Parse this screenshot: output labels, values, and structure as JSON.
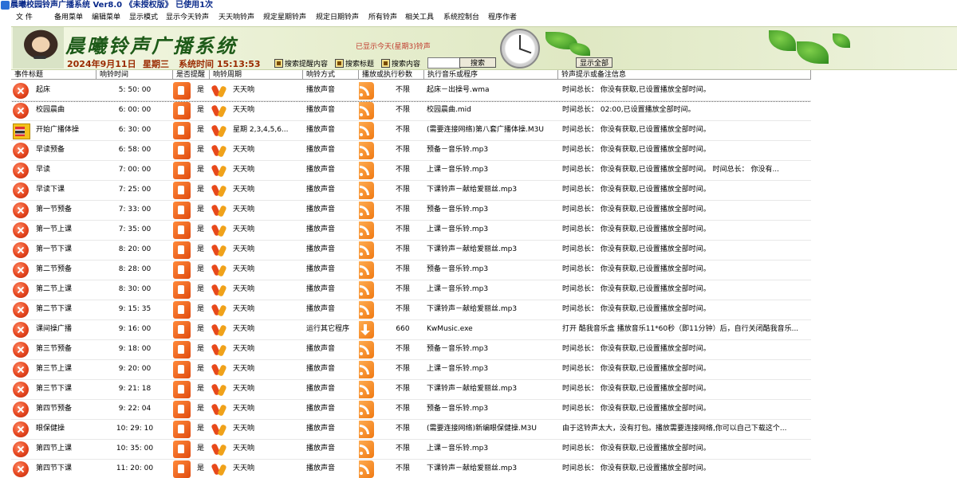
{
  "window": {
    "title": "晨曦校园铃声广播系统 Ver8.0 《未授权版》  已使用1次"
  },
  "menu": [
    "文 件",
    "备用菜单",
    "编辑菜单",
    "显示模式",
    "显示今天铃声",
    "天天响铃声",
    "规定星期铃声",
    "规定日期铃声",
    "所有铃声",
    "相关工具",
    "系统控制台",
    "程序作者"
  ],
  "banner": {
    "logo_text": "晨曦铃声广播系统",
    "today_shown": "已显示今天(星期3)铃声",
    "date": "2024年9月11日",
    "weekday": "星期三",
    "system_time": "系统时间 15:13:53",
    "search_options": [
      "搜索提醒内容",
      "搜索标题",
      "搜索内容"
    ],
    "search_value": "",
    "search_button": "搜索",
    "show_all_button": "显示全部"
  },
  "columns": [
    "事件标题",
    "响铃时间",
    "是否提醒",
    "响铃周期",
    "响铃方式",
    "播放或执行秒数",
    "执行音乐或程序",
    "铃声提示或备注信息"
  ],
  "rows": [
    {
      "icon": "x-icon",
      "title": "起床",
      "time": "5: 50: 00",
      "remind": "是",
      "cycle": "天天响",
      "mode": "播放声音",
      "mode_icon": "rss-icon",
      "seconds": "不限",
      "program": "起床－出操号.wma",
      "note": "时间总长： 你没有获取,已设置播放全部时间。"
    },
    {
      "icon": "x-icon",
      "title": "校园晨曲",
      "time": "6: 00: 00",
      "remind": "是",
      "cycle": "天天响",
      "mode": "播放声音",
      "mode_icon": "rss-icon",
      "seconds": "不限",
      "program": "校园晨曲.mid",
      "note": "时间总长： 02:00,已设置播放全部时间。"
    },
    {
      "icon": "mat-icon",
      "title": "开始广播体操",
      "time": "6: 30: 00",
      "remind": "是",
      "cycle": "星期 2,3,4,5,6...",
      "mode": "播放声音",
      "mode_icon": "rss-icon",
      "seconds": "不限",
      "program": "(需要连接网络)第八套广播体操.M3U",
      "note": "时间总长： 你没有获取,已设置播放全部时间。"
    },
    {
      "icon": "x-icon",
      "title": "早读预备",
      "time": "6: 58: 00",
      "remind": "是",
      "cycle": "天天响",
      "mode": "播放声音",
      "mode_icon": "rss-icon",
      "seconds": "不限",
      "program": "预备－音乐铃.mp3",
      "note": "时间总长： 你没有获取,已设置播放全部时间。"
    },
    {
      "icon": "x-icon",
      "title": "早读",
      "time": "7: 00: 00",
      "remind": "是",
      "cycle": "天天响",
      "mode": "播放声音",
      "mode_icon": "rss-icon",
      "seconds": "不限",
      "program": "上课－音乐铃.mp3",
      "note": "时间总长： 你没有获取,已设置播放全部时间。 时间总长： 你没有..."
    },
    {
      "icon": "x-icon",
      "title": "早读下课",
      "time": "7: 25: 00",
      "remind": "是",
      "cycle": "天天响",
      "mode": "播放声音",
      "mode_icon": "rss-icon",
      "seconds": "不限",
      "program": "下课铃声－献给爱丽丝.mp3",
      "note": "时间总长： 你没有获取,已设置播放全部时间。"
    },
    {
      "icon": "x-icon",
      "title": "第一节预备",
      "time": "7: 33: 00",
      "remind": "是",
      "cycle": "天天响",
      "mode": "播放声音",
      "mode_icon": "rss-icon",
      "seconds": "不限",
      "program": "预备－音乐铃.mp3",
      "note": "时间总长： 你没有获取,已设置播放全部时间。"
    },
    {
      "icon": "x-icon",
      "title": "第一节上课",
      "time": "7: 35: 00",
      "remind": "是",
      "cycle": "天天响",
      "mode": "播放声音",
      "mode_icon": "rss-icon",
      "seconds": "不限",
      "program": "上课－音乐铃.mp3",
      "note": "时间总长： 你没有获取,已设置播放全部时间。"
    },
    {
      "icon": "x-icon",
      "title": "第一节下课",
      "time": "8: 20: 00",
      "remind": "是",
      "cycle": "天天响",
      "mode": "播放声音",
      "mode_icon": "rss-icon",
      "seconds": "不限",
      "program": "下课铃声－献给爱丽丝.mp3",
      "note": "时间总长： 你没有获取,已设置播放全部时间。"
    },
    {
      "icon": "x-icon",
      "title": "第二节预备",
      "time": "8: 28: 00",
      "remind": "是",
      "cycle": "天天响",
      "mode": "播放声音",
      "mode_icon": "rss-icon",
      "seconds": "不限",
      "program": "预备－音乐铃.mp3",
      "note": "时间总长： 你没有获取,已设置播放全部时间。"
    },
    {
      "icon": "x-icon",
      "title": "第二节上课",
      "time": "8: 30: 00",
      "remind": "是",
      "cycle": "天天响",
      "mode": "播放声音",
      "mode_icon": "rss-icon",
      "seconds": "不限",
      "program": "上课－音乐铃.mp3",
      "note": "时间总长： 你没有获取,已设置播放全部时间。"
    },
    {
      "icon": "x-icon",
      "title": "第二节下课",
      "time": "9: 15: 35",
      "remind": "是",
      "cycle": "天天响",
      "mode": "播放声音",
      "mode_icon": "rss-icon",
      "seconds": "不限",
      "program": "下课铃声－献给爱丽丝.mp3",
      "note": "时间总长： 你没有获取,已设置播放全部时间。"
    },
    {
      "icon": "x-icon",
      "title": "课间操广播",
      "time": "9: 16: 00",
      "remind": "是",
      "cycle": "天天响",
      "mode": "运行其它程序",
      "mode_icon": "download-icon",
      "seconds": "660",
      "program": "KwMusic.exe",
      "note": "打开 酷我音乐盒 播放音乐11*60秒（即11分钟）后，自行关闭酷我音乐..."
    },
    {
      "icon": "x-icon",
      "title": "第三节预备",
      "time": "9: 18: 00",
      "remind": "是",
      "cycle": "天天响",
      "mode": "播放声音",
      "mode_icon": "rss-icon",
      "seconds": "不限",
      "program": "预备－音乐铃.mp3",
      "note": "时间总长： 你没有获取,已设置播放全部时间。"
    },
    {
      "icon": "x-icon",
      "title": "第三节上课",
      "time": "9: 20: 00",
      "remind": "是",
      "cycle": "天天响",
      "mode": "播放声音",
      "mode_icon": "rss-icon",
      "seconds": "不限",
      "program": "上课－音乐铃.mp3",
      "note": "时间总长： 你没有获取,已设置播放全部时间。"
    },
    {
      "icon": "x-icon",
      "title": "第三节下课",
      "time": "9: 21: 18",
      "remind": "是",
      "cycle": "天天响",
      "mode": "播放声音",
      "mode_icon": "rss-icon",
      "seconds": "不限",
      "program": "下课铃声－献给爱丽丝.mp3",
      "note": "时间总长： 你没有获取,已设置播放全部时间。"
    },
    {
      "icon": "x-icon",
      "title": "第四节预备",
      "time": "9: 22: 04",
      "remind": "是",
      "cycle": "天天响",
      "mode": "播放声音",
      "mode_icon": "rss-icon",
      "seconds": "不限",
      "program": "预备－音乐铃.mp3",
      "note": "时间总长： 你没有获取,已设置播放全部时间。"
    },
    {
      "icon": "x-icon",
      "title": "眼保健操",
      "time": "10: 29: 10",
      "remind": "是",
      "cycle": "天天响",
      "mode": "播放声音",
      "mode_icon": "rss-icon",
      "seconds": "不限",
      "program": "(需要连接网络)新编眼保健操.M3U",
      "note": "由于这铃声太大，没有打包。播放需要连接网络,你可以自己下载这个..."
    },
    {
      "icon": "x-icon",
      "title": "第四节上课",
      "time": "10: 35: 00",
      "remind": "是",
      "cycle": "天天响",
      "mode": "播放声音",
      "mode_icon": "rss-icon",
      "seconds": "不限",
      "program": "上课－音乐铃.mp3",
      "note": "时间总长： 你没有获取,已设置播放全部时间。"
    },
    {
      "icon": "x-icon",
      "title": "第四节下课",
      "time": "11: 20: 00",
      "remind": "是",
      "cycle": "天天响",
      "mode": "播放声音",
      "mode_icon": "rss-icon",
      "seconds": "不限",
      "program": "下课铃声－献给爱丽丝.mp3",
      "note": "时间总长： 你没有获取,已设置播放全部时间。"
    }
  ]
}
